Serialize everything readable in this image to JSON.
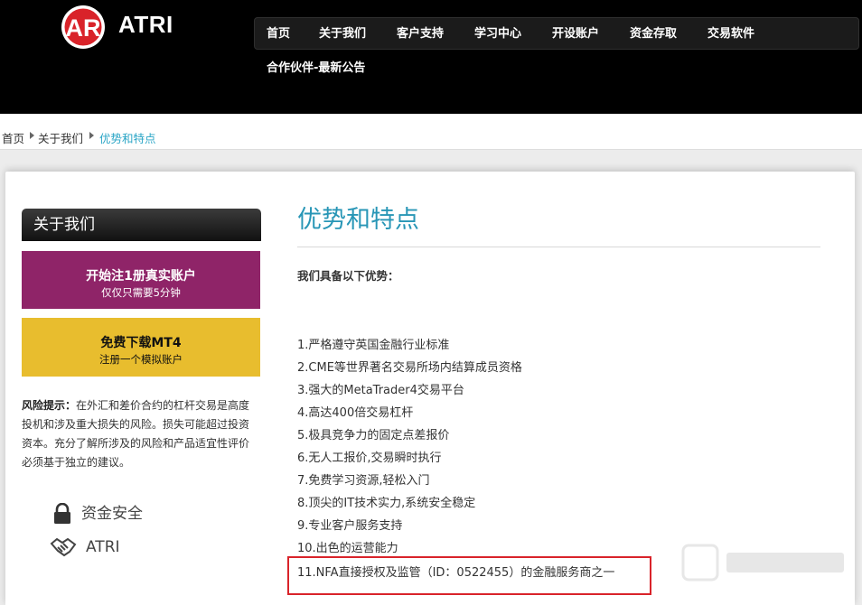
{
  "header": {
    "brand": "ATRI",
    "logo_letters": "AR",
    "nav": [
      "首页",
      "关于我们",
      "客户支持",
      "学习中心",
      "开设账户",
      "资金存取",
      "交易软件"
    ],
    "nav_row2": "合作伙伴-最新公告"
  },
  "breadcrumb": {
    "items": [
      "首页",
      "关于我们"
    ],
    "current": "优势和特点"
  },
  "sidebar": {
    "title": "关于我们",
    "cta_open": {
      "main": "开始注1册真实账户",
      "sub": "仅仅只需要5分钟"
    },
    "cta_download": {
      "main": "免费下载MT4",
      "sub": "注册一个模拟账户"
    },
    "risk_label": "风险提示：",
    "risk_text": "在外汇和差价合约的杠杆交易是高度投机和涉及重大损失的风险。损失可能超过投资资本。充分了解所涉及的风险和产品适宜性评价必须基于独立的建议。",
    "features": [
      {
        "icon": "lock-icon",
        "label": "资金安全"
      },
      {
        "icon": "handshake-icon",
        "label": "ATRI"
      }
    ]
  },
  "content": {
    "title": "优势和特点",
    "intro": "我们具备以下优势：",
    "advantages": [
      "1.严格遵守英国金融行业标准",
      "2.CME等世界著名交易所场内结算成员资格",
      "3.强大的MetaTrader4交易平台",
      "4.高达400倍交易杠杆",
      "5.极具竞争力的固定点差报价",
      "6.无人工报价,交易瞬时执行",
      "7.免费学习资源,轻松入门",
      "8.顶尖的IT技术实力,系统安全稳定",
      "9.专业客户服务支持",
      "10.出色的运营能力",
      "11.NFA直接授权及监管（ID：0522455）的金融服务商之一"
    ]
  },
  "colors": {
    "header_bg": "#000000",
    "accent_title": "#2896b6",
    "breadcrumb_current": "#2aa5c6",
    "cta_purple": "#8f2468",
    "cta_yellow": "#e8bd2e",
    "logo_red": "#d9232a",
    "highlight_border": "#d9232a"
  }
}
